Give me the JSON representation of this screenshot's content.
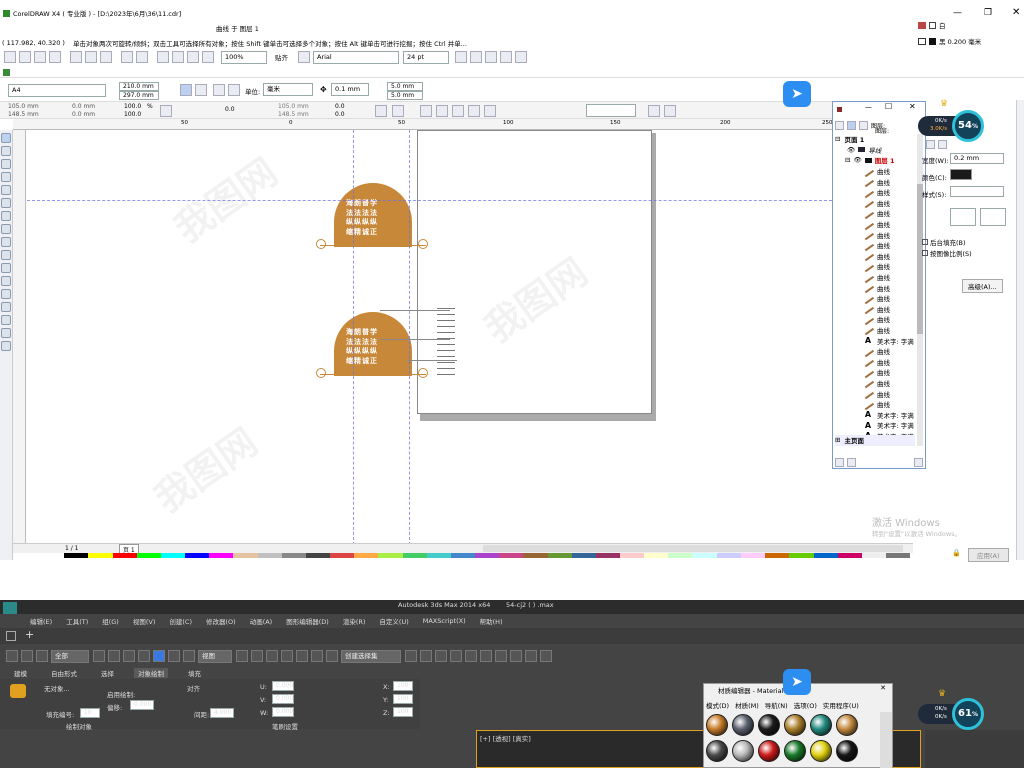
{
  "corel": {
    "title": "CorelDRAW X4 ( 专业版 ) - [D:\\2023年\\6月\\36\\11.cdr]",
    "layer_hint": "曲线 于 图层 1",
    "status_right_top": "白",
    "status_right_bottom": "黑 0.200 毫米",
    "coords": "( 117.982, 40.320 )",
    "hint": "单击对象两次可旋转/倾斜；双击工具可选择所有对象；按住 Shift 键单击可选择多个对象；按住 Alt 键单击可进行挖掘；按住 Ctrl 并单...",
    "toolbar": {
      "zoom": "100%",
      "snap": "贴齐",
      "font": "Arial",
      "font_size": "24 pt"
    },
    "propbar": {
      "page_size": "A4",
      "width": "210.0 mm",
      "height": "297.0 mm",
      "unit_label": "单位:",
      "unit": "毫米",
      "nudge": "0.1 mm",
      "dup_x": "5.0 mm",
      "dup_y": "5.0 mm"
    },
    "propbar2": {
      "x": "105.0 mm",
      "y": "148.5 mm",
      "w": "0.0 mm",
      "h": "0.0 mm",
      "sx": "100.0",
      "sy": "100.0",
      "pct": "%",
      "rot": "0.0",
      "x2": "105.0 mm",
      "y2": "148.5 mm",
      "v1": "0.0",
      "v2": "0.0"
    },
    "ruler_ticks": [
      "50",
      "0",
      "50",
      "100",
      "150",
      "200",
      "250"
    ],
    "badge": {
      "lines": [
        "海",
        "朗",
        "普",
        "学",
        "法",
        "法",
        "法",
        "法",
        "纵",
        "纵",
        "纵",
        "纵",
        "缩",
        "精",
        "诚",
        "正"
      ],
      "lines_text": [
        "海朗普学",
        "法法法法",
        "纵纵纵纵",
        "缩精诚正"
      ]
    },
    "page_nav": "1 / 1",
    "page_tab": "页 1",
    "watermark_activate": "激活 Windows",
    "watermark_activate_sub": "转到\"设置\"以激活 Windows。"
  },
  "objmgr": {
    "page_label": "页面 1",
    "layer_label": "图层 1",
    "guides_label": "导线",
    "layer_head": "图层:",
    "layer_head2": "图层:",
    "rows": [
      "曲线",
      "曲线",
      "曲线",
      "曲线",
      "曲线",
      "曲线",
      "曲线",
      "曲线",
      "曲线",
      "曲线",
      "曲线",
      "曲线",
      "曲线",
      "曲线",
      "曲线",
      "曲线",
      "美术字: 字满",
      "曲线",
      "曲线",
      "曲线",
      "曲线",
      "曲线",
      "曲线",
      "美术字: 字满",
      "美术字: 字满",
      "美术字: 字满"
    ],
    "row_types": [
      "p",
      "p",
      "p",
      "p",
      "p",
      "p",
      "p",
      "p",
      "p",
      "p",
      "p",
      "p",
      "p",
      "p",
      "p",
      "p",
      "a",
      "p",
      "p",
      "p",
      "p",
      "p",
      "p",
      "a",
      "a",
      "a"
    ],
    "master": "主页面"
  },
  "rightpanel": {
    "width_label": "宽度(W):",
    "width_val": "0.2 mm",
    "color_label": "颜色(C):",
    "style_label": "样式(S):",
    "behind_fill": "后台填充(B)",
    "scale_img": "按图像比例(S)",
    "advanced": "高级(A)...",
    "apply": "应用(A)"
  },
  "netmon": {
    "up": "0K/s",
    "down": "3.0K/s",
    "pct": "54"
  },
  "netmon2": {
    "up": "0K/s",
    "down": "0K/s",
    "pct": "61"
  },
  "max": {
    "title": "Autodesk 3ds Max  2014 x64",
    "file": "54-cj2 ( ) .max",
    "menus": [
      "编辑(E)",
      "工具(T)",
      "组(G)",
      "视图(V)",
      "创建(C)",
      "修改器(O)",
      "动画(A)",
      "图形编辑器(D)",
      "渲染(R)",
      "自定义(U)",
      "MAXScript(X)",
      "帮助(H)"
    ],
    "filter": "全部",
    "view": "视图",
    "selset": "创建选择集",
    "tabs": [
      "建模",
      "自由形式",
      "选择",
      "对象绘制",
      "填充"
    ],
    "paint_label": "无对象...",
    "paint_use": "启用绘制:",
    "paint_offset": "偏移:",
    "paint_offset_val": "0.000",
    "fill_num": "填充编号:",
    "fill_num_val": "10",
    "align_label": "对齐",
    "spacing_label": "间距:",
    "spacing_val": "4.000",
    "u": "U:",
    "u_val": "0.000",
    "v": "V:",
    "v_val": "0.000",
    "w": "W:",
    "w_val": "0.000",
    "x": "X:",
    "y": "Y:",
    "z": "Z:",
    "x_val": "100",
    "y_val": "100",
    "z_val": "100",
    "bottom_left": "绘制对象",
    "bottom_right": "笔刷设置",
    "viewport_label": "[+] [透视] [真实]"
  },
  "matedit": {
    "title": "材质编辑器 - Material #",
    "menus": [
      "模式(D)",
      "材质(M)",
      "导航(N)",
      "选项(O)",
      "实用程序(U)"
    ],
    "balls": [
      "#c77b2a",
      "#5b6170",
      "#1b1b1b",
      "#ab7f2c",
      "#238a7e",
      "#c38a3e",
      "#4a4a4a",
      "#b8b8b8",
      "#cc1a1a",
      "#1a7a2a",
      "#e0d010",
      "#161616"
    ]
  },
  "colors": {
    "accent": "#c8883a",
    "selection_blue": "#316ac5",
    "dark_bg": "#444444"
  }
}
